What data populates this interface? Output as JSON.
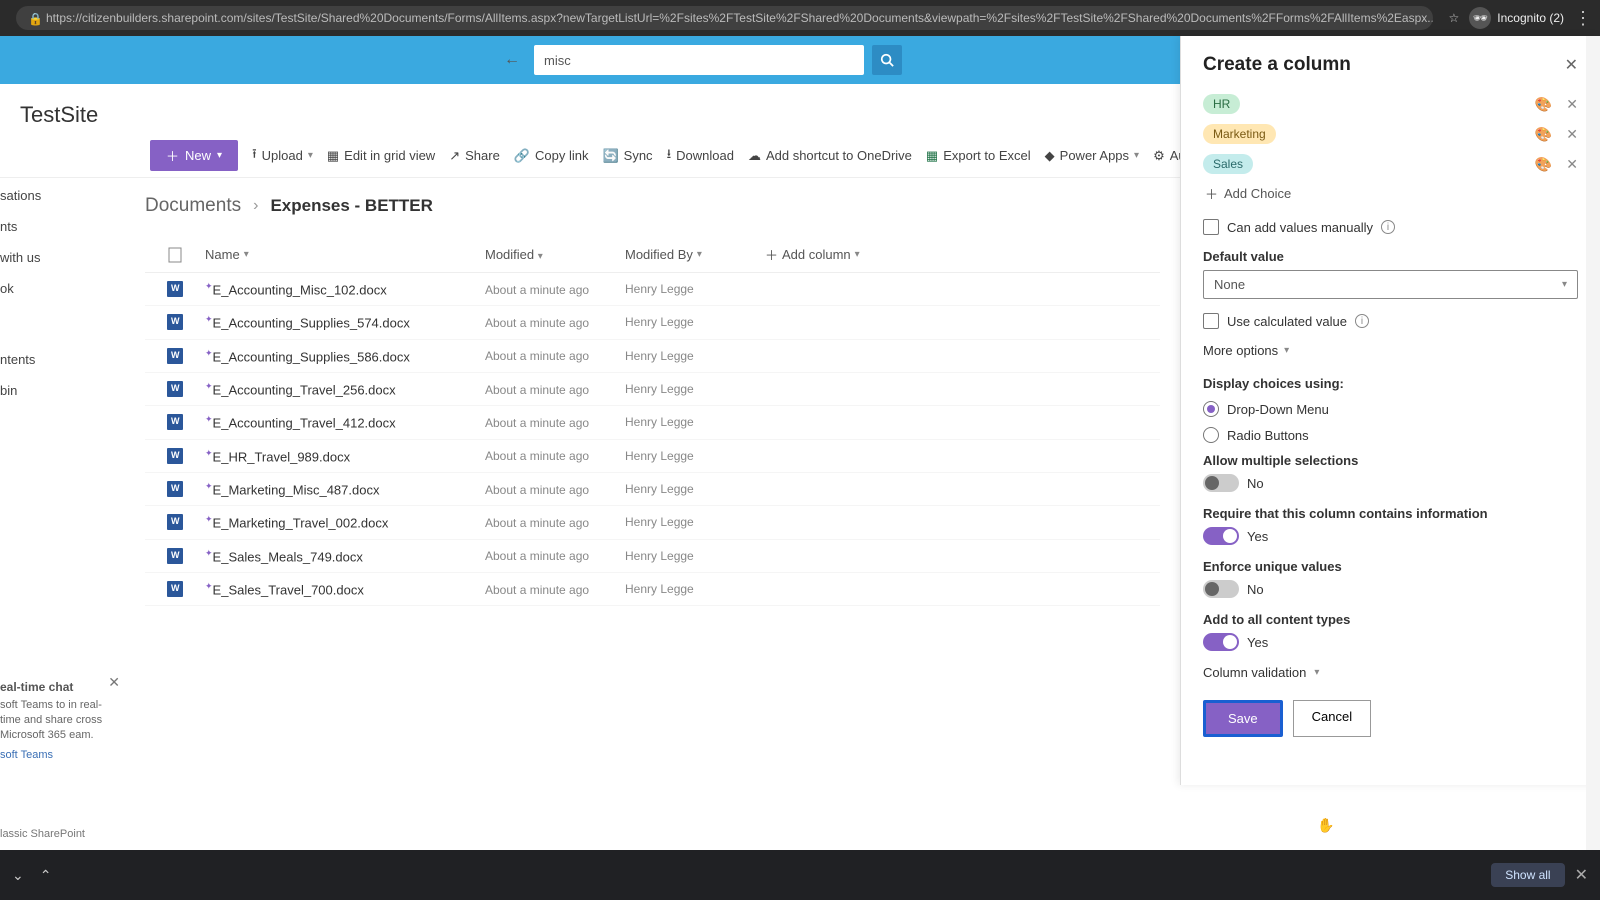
{
  "browser": {
    "url": "https://citizenbuilders.sharepoint.com/sites/TestSite/Shared%20Documents/Forms/AllItems.aspx?newTargetListUrl=%2Fsites%2FTestSite%2FShared%20Documents&viewpath=%2Fsites%2FTestSite%2FShared%20Documents%2FForms%2FAllItems%2Easpx...",
    "incognito_label": "Incognito (2)"
  },
  "search": {
    "value": "misc"
  },
  "site": {
    "title": "TestSite"
  },
  "toolbar": {
    "new": "New",
    "upload": "Upload",
    "edit_grid": "Edit in grid view",
    "share": "Share",
    "copy_link": "Copy link",
    "sync": "Sync",
    "download": "Download",
    "shortcut": "Add shortcut to OneDrive",
    "excel": "Export to Excel",
    "power_apps": "Power Apps",
    "automate": "Automate"
  },
  "left_nav": {
    "items": [
      "sations",
      "nts",
      "with us",
      "ok",
      "ntents",
      "bin"
    ]
  },
  "breadcrumb": {
    "library": "Documents",
    "folder": "Expenses - BETTER"
  },
  "columns": {
    "name": "Name",
    "modified": "Modified",
    "modified_by": "Modified By",
    "add_column": "Add column"
  },
  "files": [
    {
      "name": "E_Accounting_Misc_102.docx",
      "modified": "About a minute ago",
      "by": "Henry Legge"
    },
    {
      "name": "E_Accounting_Supplies_574.docx",
      "modified": "About a minute ago",
      "by": "Henry Legge"
    },
    {
      "name": "E_Accounting_Supplies_586.docx",
      "modified": "About a minute ago",
      "by": "Henry Legge"
    },
    {
      "name": "E_Accounting_Travel_256.docx",
      "modified": "About a minute ago",
      "by": "Henry Legge"
    },
    {
      "name": "E_Accounting_Travel_412.docx",
      "modified": "About a minute ago",
      "by": "Henry Legge"
    },
    {
      "name": "E_HR_Travel_989.docx",
      "modified": "About a minute ago",
      "by": "Henry Legge"
    },
    {
      "name": "E_Marketing_Misc_487.docx",
      "modified": "About a minute ago",
      "by": "Henry Legge"
    },
    {
      "name": "E_Marketing_Travel_002.docx",
      "modified": "About a minute ago",
      "by": "Henry Legge"
    },
    {
      "name": "E_Sales_Meals_749.docx",
      "modified": "About a minute ago",
      "by": "Henry Legge"
    },
    {
      "name": "E_Sales_Travel_700.docx",
      "modified": "About a minute ago",
      "by": "Henry Legge"
    }
  ],
  "panel": {
    "title": "Create a column",
    "choices": [
      {
        "label": "HR",
        "cls": "pill-hr"
      },
      {
        "label": "Marketing",
        "cls": "pill-mkt"
      },
      {
        "label": "Sales",
        "cls": "pill-sales"
      }
    ],
    "add_choice": "Add Choice",
    "can_add_manually": "Can add values manually",
    "default_value_label": "Default value",
    "default_value": "None",
    "use_calc": "Use calculated value",
    "more_options": "More options",
    "display_label": "Display choices using:",
    "radio_dd": "Drop-Down Menu",
    "radio_rb": "Radio Buttons",
    "allow_multi_label": "Allow multiple selections",
    "allow_multi_val": "No",
    "require_label": "Require that this column contains information",
    "require_val": "Yes",
    "unique_label": "Enforce unique values",
    "unique_val": "No",
    "add_all_label": "Add to all content types",
    "add_all_val": "Yes",
    "col_validation": "Column validation",
    "save": "Save",
    "cancel": "Cancel"
  },
  "chat": {
    "title": "eal-time chat",
    "body": "soft Teams to in real-time and share cross Microsoft 365 eam.",
    "link": "soft Teams"
  },
  "classic_link": "lassic SharePoint",
  "bottom": {
    "show_all": "Show all"
  }
}
